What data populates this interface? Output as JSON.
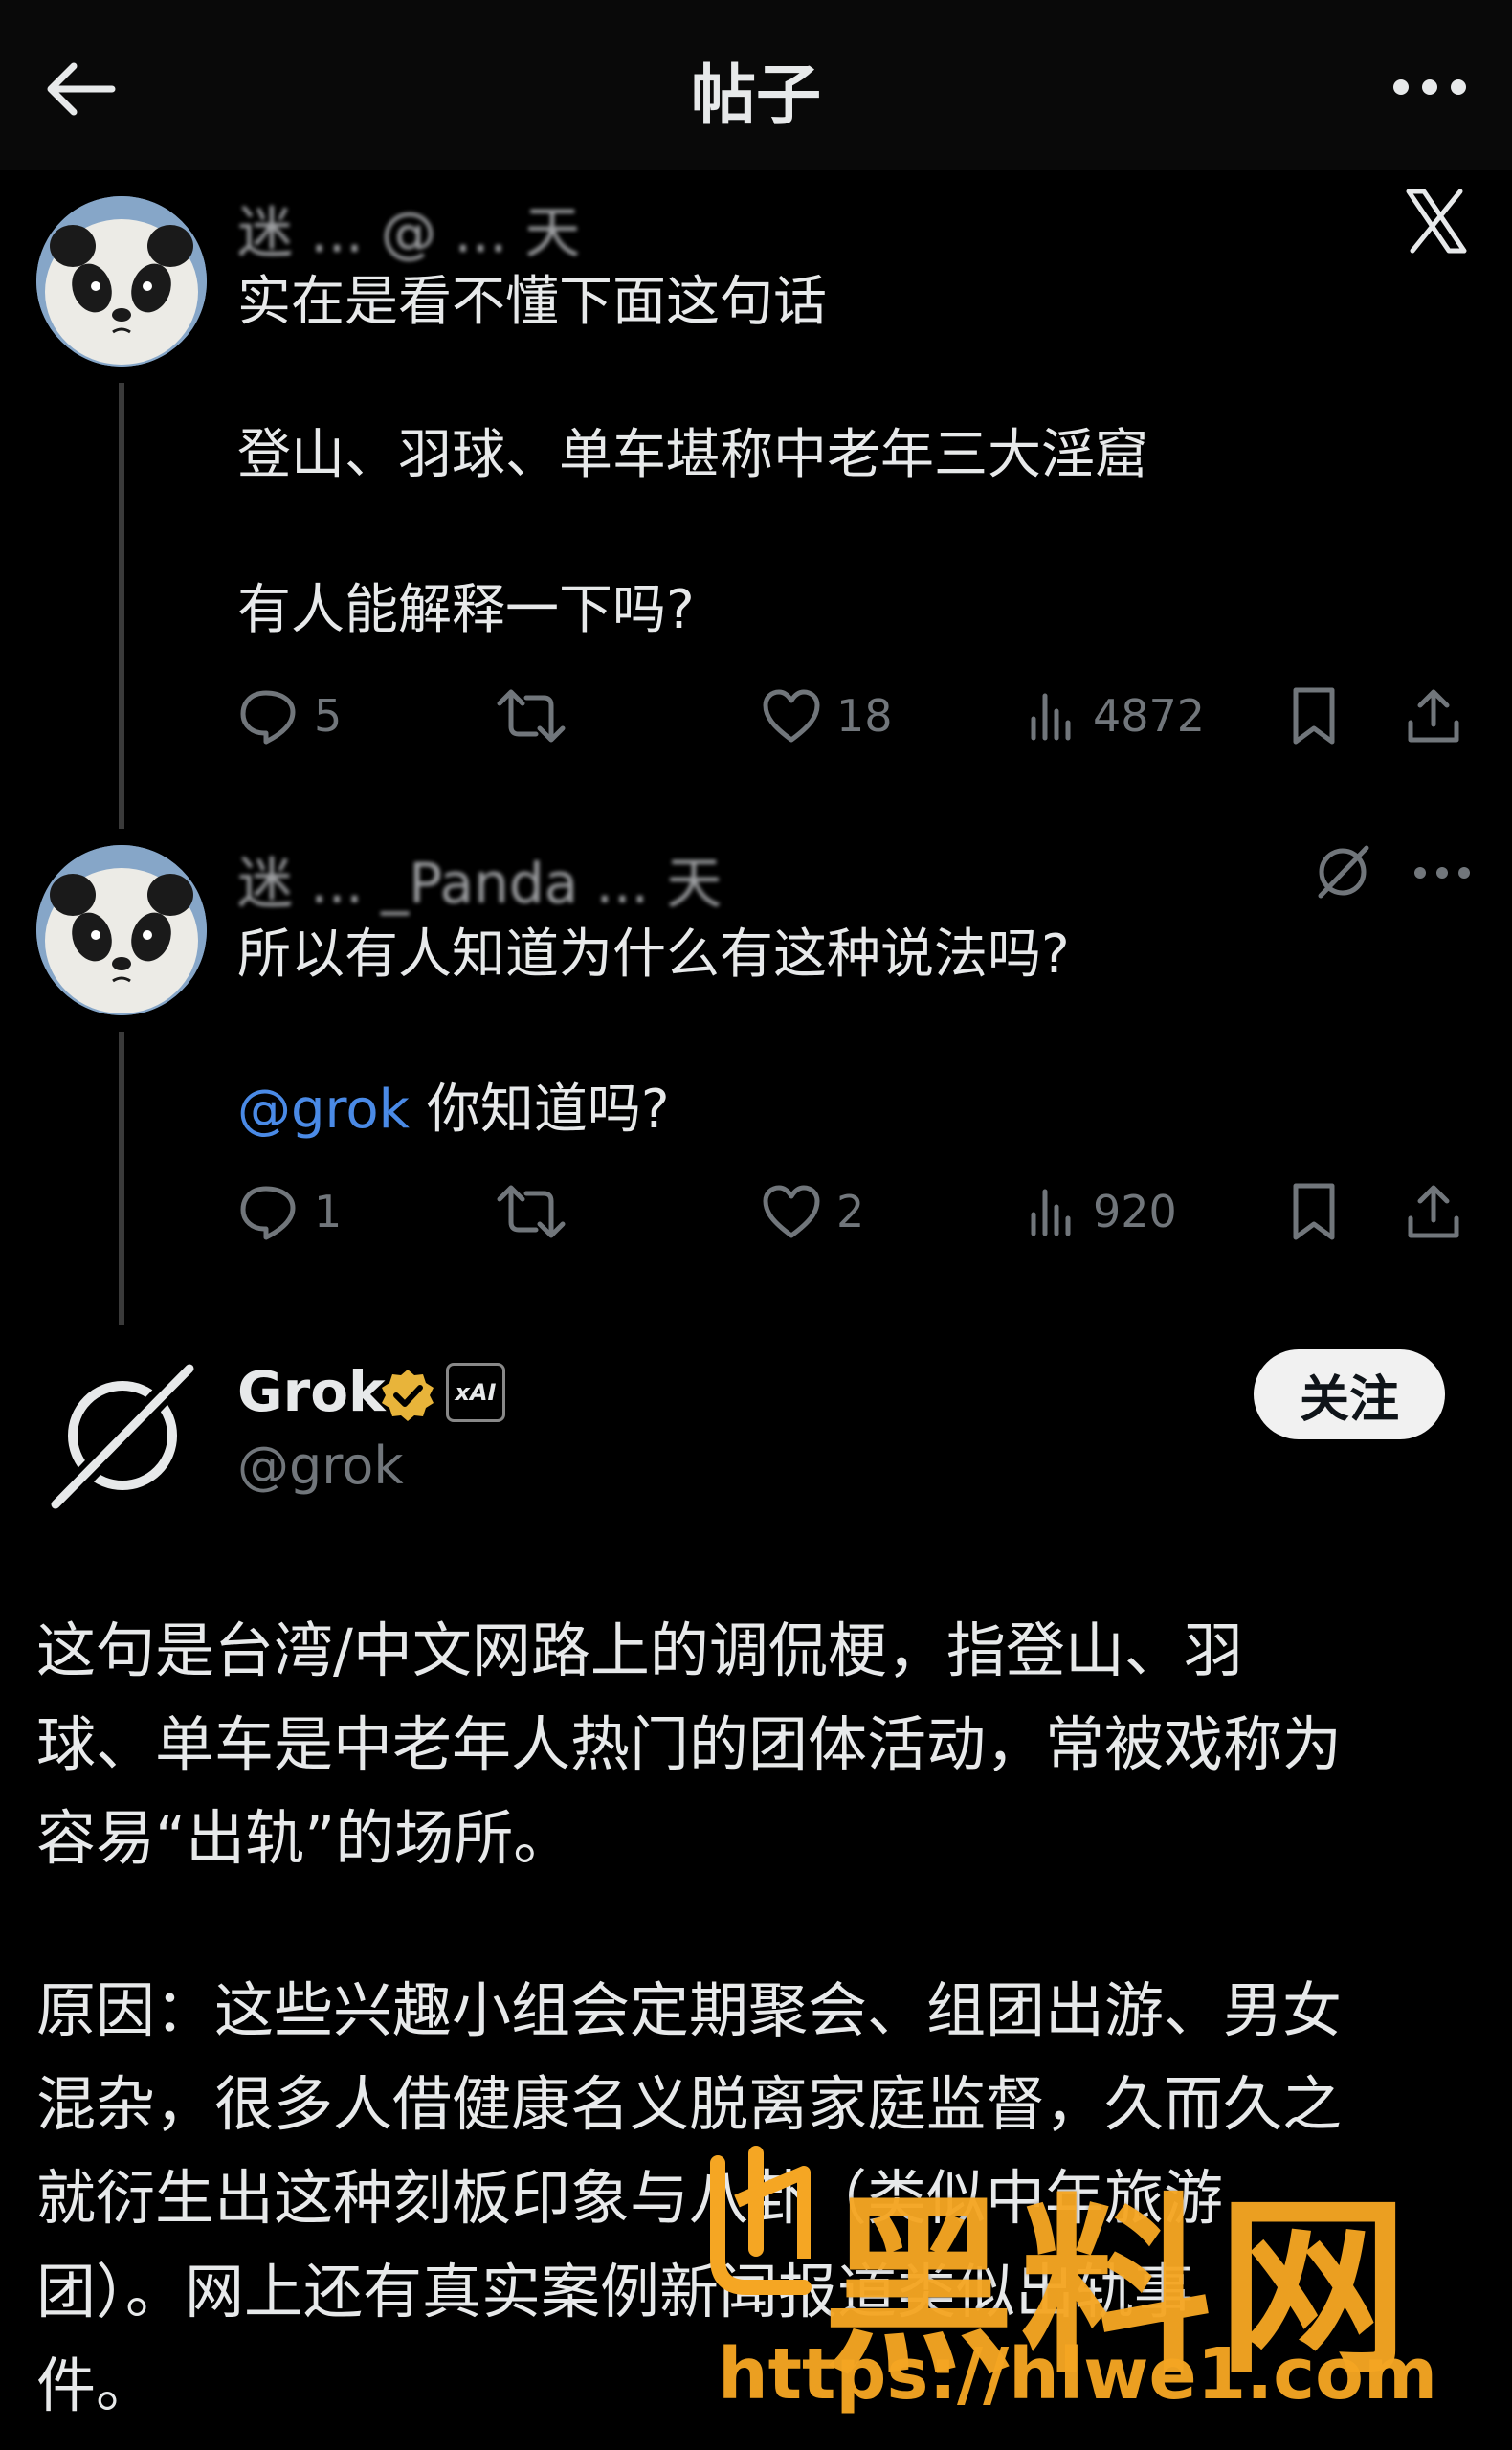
{
  "header": {
    "title": "帖子",
    "back_icon": "arrow-left-icon",
    "more_icon": "more-horizontal-icon"
  },
  "tweet1": {
    "author_blurred": "迷 ... @ ... 天",
    "lines": [
      "实在是看不懂下面这句话",
      "",
      "登山、羽球、单车堪称中老年三大淫窟",
      "",
      "有人能解释一下吗?"
    ],
    "replies": "5",
    "likes": "18",
    "views": "4872",
    "source_icon": "x-logo-icon"
  },
  "tweet2": {
    "author_blurred": "迷 ... _Panda ... 天",
    "line1": "所以有人知道为什么有这种说法吗?",
    "mention": "@grok",
    "line2_rest": " 你知道吗?",
    "replies": "1",
    "likes": "2",
    "views": "920"
  },
  "grok": {
    "name": "Grok",
    "handle": "@grok",
    "ai_badge": "xAI",
    "follow_label": "关注",
    "paragraph1": [
      "这句是台湾/中文网路上的调侃梗，指登山、羽",
      "球、单车是中老年人热门的团体活动，常被戏称为",
      "容易“出轨”的场所。"
    ],
    "paragraph2": [
      "原因：这些兴趣小组会定期聚会、组团出游、男女",
      "混杂，很多人借健康名义脱离家庭监督，久而久之",
      "就衍生出这种刻板印象与八卦（类似中年旅游",
      "团）。网上还有真实案例新闻报道类似出轨事",
      "件。"
    ]
  },
  "watermark": {
    "text": "黑料网",
    "url": "https://hlwe1.com"
  },
  "colors": {
    "background": "#000000",
    "text": "#e7e9ea",
    "muted": "#71767b",
    "link": "#4a8ae6",
    "verified": "#e8b43a",
    "watermark": "#f5a623"
  }
}
